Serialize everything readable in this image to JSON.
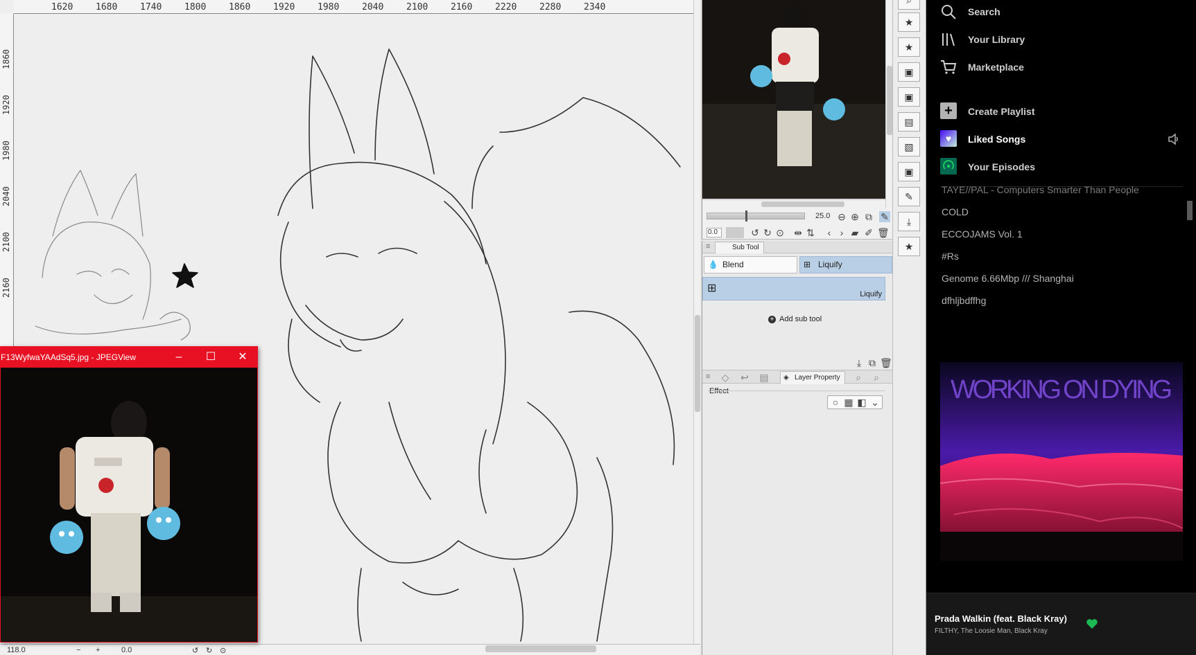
{
  "canvas": {
    "h_ruler_ticks": [
      "1620",
      "1680",
      "1740",
      "1800",
      "1860",
      "1920",
      "1980",
      "2040",
      "2100",
      "2160",
      "2220",
      "2280",
      "2340"
    ],
    "v_ruler_ticks": [
      "1860",
      "1920",
      "1980",
      "2040",
      "2100",
      "2160"
    ],
    "status": {
      "zoom": "118.0",
      "rotation": "0.0"
    }
  },
  "jpegview": {
    "title": "F13WyfwaYAAdSq5.jpg - JPEGView",
    "minimize_glyph": "–",
    "maximize_glyph": "☐",
    "close_glyph": "✕"
  },
  "navigator": {
    "zoom": "25.0",
    "rotation": "0.0"
  },
  "subtool": {
    "tab_label": "Sub Tool",
    "blend_label": "Blend",
    "liquify_label": "Liquify",
    "selected_item_label": "Liquify",
    "add_label": "Add sub tool"
  },
  "tool_property": {
    "tab_label": "Layer Property",
    "effect_label": "Effect"
  },
  "spotify": {
    "nav": {
      "search": "Search",
      "library": "Your Library",
      "marketplace": "Marketplace"
    },
    "actions": {
      "create_playlist": "Create Playlist",
      "liked_songs": "Liked Songs",
      "your_episodes": "Your Episodes"
    },
    "playlists": [
      "TAYE//PAL - Computers Smarter Than People",
      "COLD",
      "ECCOJAMS Vol. 1",
      "#Rs",
      "Genome 6.66Mbp /// Shanghai",
      "dfhljbdffhg"
    ],
    "album_art_text": "WORKING ON DYING",
    "now_playing": {
      "title": "Prada Walkin (feat. Black Kray)",
      "artists": "FILTHY, The Loosie Man, Black Kray"
    },
    "colors": {
      "background": "#000000",
      "accent_green": "#1db954",
      "liked_purple": "#7b3ff2"
    }
  }
}
